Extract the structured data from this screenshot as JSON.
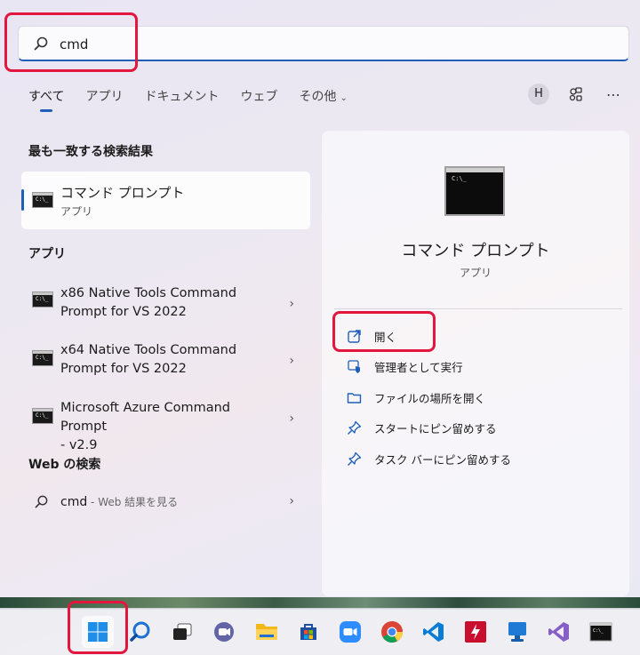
{
  "search": {
    "value": "cmd"
  },
  "tabs": [
    {
      "label": "すべて",
      "active": true
    },
    {
      "label": "アプリ"
    },
    {
      "label": "ドキュメント"
    },
    {
      "label": "ウェブ"
    },
    {
      "label": "その他"
    }
  ],
  "header": {
    "avatar_letter": "H"
  },
  "best_match": {
    "heading": "最も一致する検索結果",
    "title": "コマンド プロンプト",
    "subtitle": "アプリ"
  },
  "apps": {
    "heading": "アプリ",
    "items": [
      {
        "line1": "x86 Native Tools Command",
        "line2": "Prompt for VS 2022"
      },
      {
        "line1": "x64 Native Tools Command",
        "line2": "Prompt for VS 2022"
      },
      {
        "line1": "Microsoft Azure Command Prompt",
        "line2": "- v2.9"
      }
    ]
  },
  "web": {
    "heading": "Web の検索",
    "query": "cmd",
    "hint": " - Web 結果を見る"
  },
  "panel": {
    "title": "コマンド プロンプト",
    "subtitle": "アプリ",
    "actions": [
      {
        "label": "開く",
        "icon": "open-external-icon"
      },
      {
        "label": "管理者として実行",
        "icon": "shield-icon"
      },
      {
        "label": "ファイルの場所を開く",
        "icon": "folder-icon"
      },
      {
        "label": "スタートにピン留めする",
        "icon": "pin-icon"
      },
      {
        "label": "タスク バーにピン留めする",
        "icon": "pin-icon"
      }
    ]
  },
  "colors": {
    "accent": "#1f5fb8",
    "highlight": "#e3173e"
  },
  "taskbar": [
    "start-icon",
    "search-icon",
    "task-view-icon",
    "chat-icon",
    "file-explorer-icon",
    "store-icon",
    "zoom-icon",
    "chrome-icon",
    "vscode-icon",
    "acrobat-icon",
    "remote-desktop-icon",
    "visual-studio-icon",
    "terminal-icon"
  ]
}
